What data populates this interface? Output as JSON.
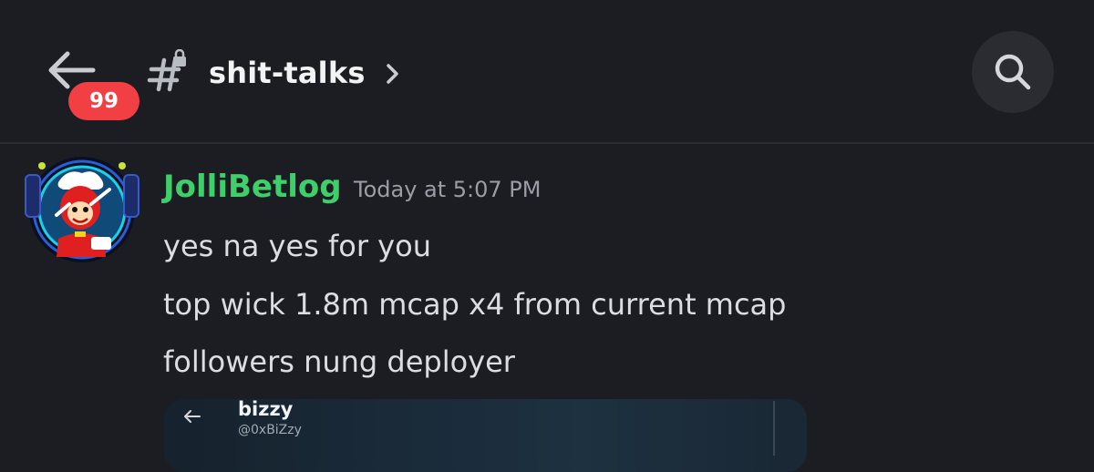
{
  "header": {
    "back_icon": "arrow-left-icon",
    "unread_badge": "99",
    "channel_icon": "locked-hashtag-icon",
    "channel_name": "shit-talks",
    "chevron_icon": "chevron-right-icon",
    "search_icon": "search-icon"
  },
  "message": {
    "avatar": "jollibee-avatar",
    "username": "JolliBetlog",
    "username_color": "#3ecf6b",
    "timestamp": "Today at 5:07 PM",
    "lines": [
      "yes na yes for you",
      "top wick 1.8m mcap x4 from current mcap",
      "followers nung deployer"
    ]
  },
  "embed": {
    "back_icon": "arrow-left-icon",
    "name": "bizzy",
    "handle": "@0xBiZzy"
  },
  "colors": {
    "background": "#1c1d22",
    "badge": "#f23f43",
    "accent_green": "#3ecf6b"
  }
}
